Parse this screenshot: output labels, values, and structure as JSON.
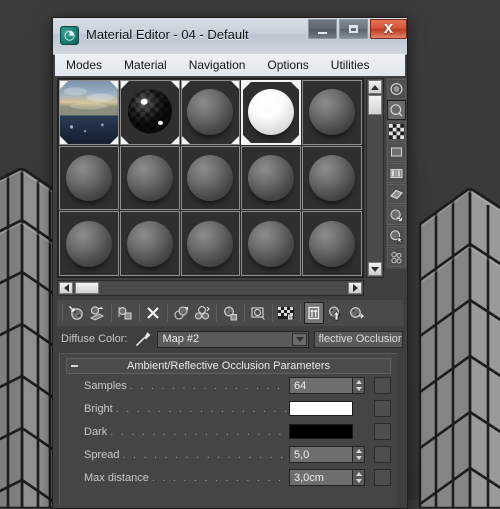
{
  "window": {
    "title": "Material Editor - 04 - Default",
    "app_icon": "3dsmax-logo-icon",
    "buttons": {
      "minimize": "minimize-icon",
      "maximize": "maximize-icon",
      "close": "X"
    }
  },
  "menubar": {
    "items": [
      {
        "label": "Modes"
      },
      {
        "label": "Material"
      },
      {
        "label": "Navigation"
      },
      {
        "label": "Options"
      },
      {
        "label": "Utilities"
      }
    ]
  },
  "sample_slots": {
    "columns": 5,
    "rows": 3,
    "selected_index": 3,
    "slots": [
      {
        "index": 0,
        "kind": "environment-map",
        "used": true,
        "selected": false
      },
      {
        "index": 1,
        "kind": "checker-sphere",
        "used": true,
        "selected": false
      },
      {
        "index": 2,
        "kind": "gray-sphere",
        "used": true,
        "selected": false
      },
      {
        "index": 3,
        "kind": "bright-sphere",
        "used": true,
        "selected": true
      },
      {
        "index": 4,
        "kind": "gray-sphere",
        "used": false,
        "selected": false
      },
      {
        "index": 5,
        "kind": "gray-sphere",
        "used": false,
        "selected": false
      },
      {
        "index": 6,
        "kind": "gray-sphere",
        "used": false,
        "selected": false
      },
      {
        "index": 7,
        "kind": "gray-sphere",
        "used": false,
        "selected": false
      },
      {
        "index": 8,
        "kind": "gray-sphere",
        "used": false,
        "selected": false
      },
      {
        "index": 9,
        "kind": "gray-sphere",
        "used": false,
        "selected": false
      },
      {
        "index": 10,
        "kind": "gray-sphere",
        "used": false,
        "selected": false
      },
      {
        "index": 11,
        "kind": "gray-sphere",
        "used": false,
        "selected": false
      },
      {
        "index": 12,
        "kind": "gray-sphere",
        "used": false,
        "selected": false
      },
      {
        "index": 13,
        "kind": "gray-sphere",
        "used": false,
        "selected": false
      },
      {
        "index": 14,
        "kind": "gray-sphere",
        "used": false,
        "selected": false
      }
    ]
  },
  "side_toolbar": {
    "items": [
      {
        "name": "sample-type-icon",
        "active": false
      },
      {
        "name": "backlight-icon",
        "active": true
      },
      {
        "name": "background-checker-icon",
        "active": false
      },
      {
        "name": "sample-uv-tiling-icon",
        "active": false
      },
      {
        "name": "video-color-check-icon",
        "active": false
      },
      {
        "name": "make-preview-icon",
        "active": false
      },
      {
        "name": "options-icon",
        "active": false
      },
      {
        "name": "select-by-material-icon",
        "active": false
      },
      {
        "name": "material-id-channel-icon",
        "active": false
      }
    ]
  },
  "bottom_toolbar": {
    "items": [
      {
        "name": "get-material-icon"
      },
      {
        "name": "put-material-to-scene-icon"
      },
      {
        "name": "assign-material-to-selection-icon"
      },
      {
        "name": "reset-map-icon"
      },
      {
        "name": "make-material-copy-icon"
      },
      {
        "name": "make-unique-icon"
      },
      {
        "name": "put-to-library-icon"
      },
      {
        "name": "material-effects-channel-icon"
      },
      {
        "name": "show-map-in-viewport-icon"
      },
      {
        "name": "show-end-result-icon",
        "active": true
      },
      {
        "name": "go-to-parent-icon"
      },
      {
        "name": "go-forward-to-sibling-icon"
      }
    ]
  },
  "diffuse_row": {
    "label": "Diffuse Color:",
    "eyedropper_icon": "eyedropper-icon",
    "map_name": "Map #2",
    "dropdown_icon": "chevron-down-icon",
    "type_button": "flective Occlusion"
  },
  "rollout": {
    "collapse_icon": "minus-icon",
    "title": "Ambient/Reflective Occlusion Parameters",
    "params": [
      {
        "label": "Samples",
        "kind": "spinner",
        "value": "64",
        "map_button": "map-slot-button"
      },
      {
        "label": "Bright",
        "kind": "color",
        "value": "#ffffff",
        "map_button": "map-slot-button"
      },
      {
        "label": "Dark",
        "kind": "color",
        "value": "#000000",
        "map_button": "map-slot-button"
      },
      {
        "label": "Spread",
        "kind": "spinner",
        "value": "5,0",
        "map_button": "map-slot-button"
      },
      {
        "label": "Max distance",
        "kind": "spinner",
        "value": "3,0cm",
        "map_button": "map-slot-button"
      }
    ]
  },
  "viewport": {
    "description": "3ds Max viewport with gray wireframe building geometry",
    "background_color": "#3a3a3a"
  },
  "dots": ". . . . . . . . . . . . . . . . . . . . . . . . . . . . . . . . . . . . . . . ."
}
